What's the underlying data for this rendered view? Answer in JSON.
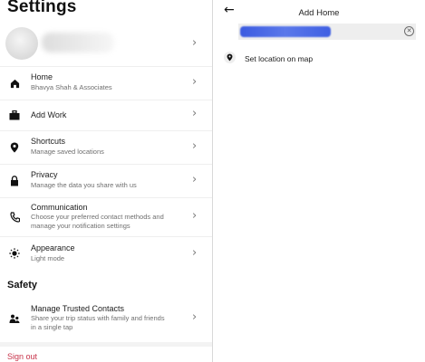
{
  "settings": {
    "title": "Settings",
    "items": [
      {
        "title": "Home",
        "sub": "Bhavya Shah & Associates",
        "icon": "home-icon"
      },
      {
        "title": "Add Work",
        "icon": "briefcase-icon"
      },
      {
        "title": "Shortcuts",
        "sub": "Manage saved locations",
        "icon": "location-pin-icon"
      },
      {
        "title": "Privacy",
        "sub": "Manage the data you share with us",
        "icon": "lock-icon"
      },
      {
        "title": "Communication",
        "sub1": "Choose your preferred contact methods and",
        "sub2": "manage your notification settings",
        "icon": "phone-icon"
      },
      {
        "title": "Appearance",
        "sub": "Light mode",
        "icon": "sun-icon"
      }
    ],
    "safety_title": "Safety",
    "trusted": {
      "title": "Manage Trusted Contacts",
      "sub1": "Share your trip status with family and friends",
      "sub2": "in a single tap",
      "icon": "people-icon"
    },
    "signout": "Sign out",
    "accent_color": "#c8334a"
  },
  "add_home": {
    "title": "Add Home",
    "search_placeholder": "",
    "set_location": "Set location on map"
  }
}
